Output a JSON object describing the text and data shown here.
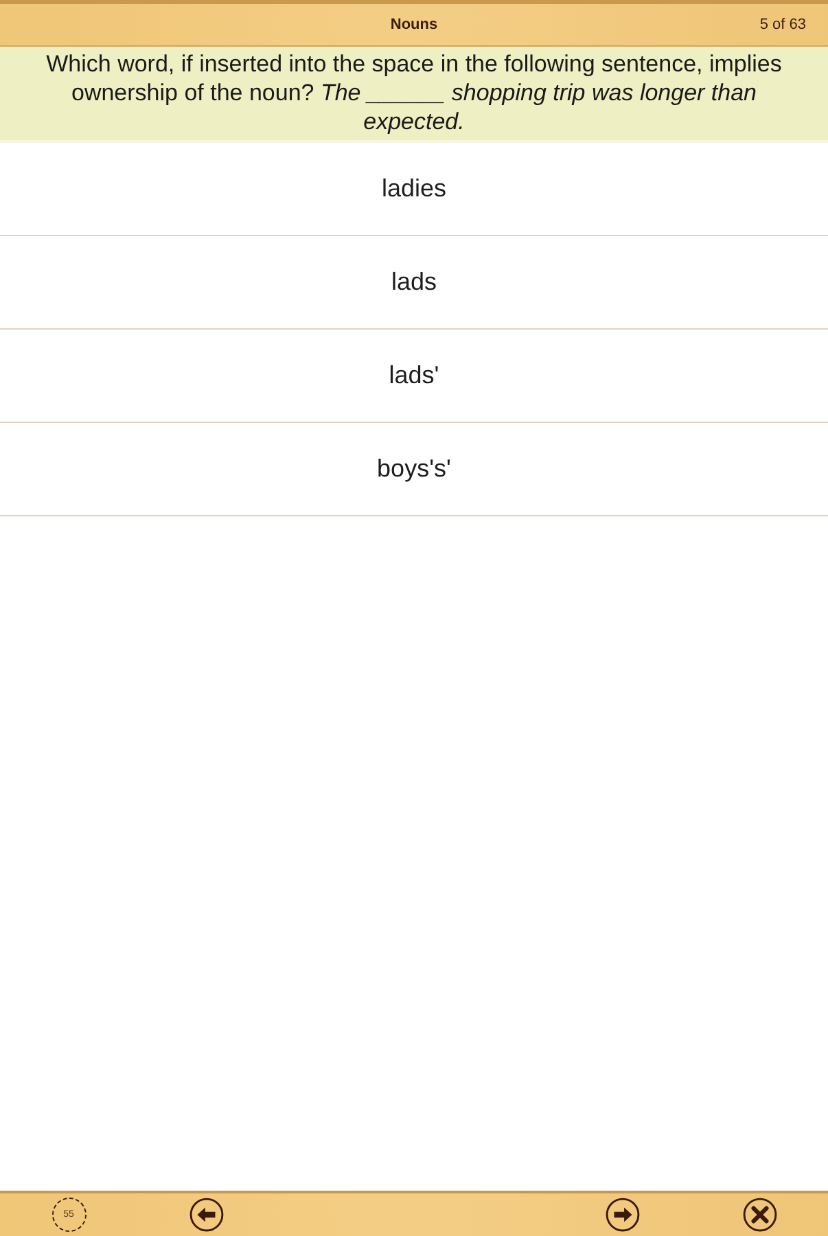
{
  "header": {
    "title": "Nouns",
    "progress": "5 of 63"
  },
  "question": {
    "text": "Which word, if inserted into the space in the following sentence, implies ownership of the noun? *The ______ shopping trip was longer than expected.*"
  },
  "answers": [
    {
      "label": "ladies"
    },
    {
      "label": "lads"
    },
    {
      "label": "lads'"
    },
    {
      "label": "boys's'"
    }
  ],
  "toolbar": {
    "timer": "55",
    "buttons": [
      {
        "kind": "back"
      },
      {
        "kind": "next"
      },
      {
        "kind": "close"
      }
    ]
  }
}
